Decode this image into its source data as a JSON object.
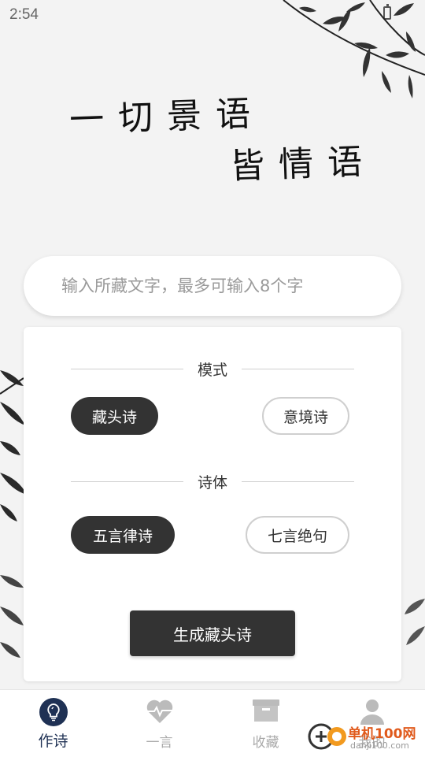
{
  "status_bar": {
    "time": "2:54"
  },
  "hero": {
    "line1": "一切景语",
    "line2": "皆情语"
  },
  "search": {
    "placeholder": "输入所藏文字，最多可输入8个字"
  },
  "mode_section": {
    "title": "模式",
    "options": [
      {
        "label": "藏头诗",
        "selected": true
      },
      {
        "label": "意境诗",
        "selected": false
      }
    ]
  },
  "style_section": {
    "title": "诗体",
    "options": [
      {
        "label": "五言律诗",
        "selected": true
      },
      {
        "label": "七言绝句",
        "selected": false
      }
    ]
  },
  "generate_button": {
    "label": "生成藏头诗"
  },
  "tab_bar": {
    "tabs": [
      {
        "label": "作诗",
        "icon": "lightbulb-icon",
        "active": true
      },
      {
        "label": "一言",
        "icon": "heartbeat-icon",
        "active": false
      },
      {
        "label": "收藏",
        "icon": "box-icon",
        "active": false
      },
      {
        "label": "我的",
        "icon": "user-icon",
        "active": false
      }
    ]
  },
  "watermark": {
    "brand": "单机100网",
    "url": "danji100.com"
  },
  "colors": {
    "accent": "#1f3154",
    "dark": "#333333",
    "background": "#f3f3f3"
  }
}
